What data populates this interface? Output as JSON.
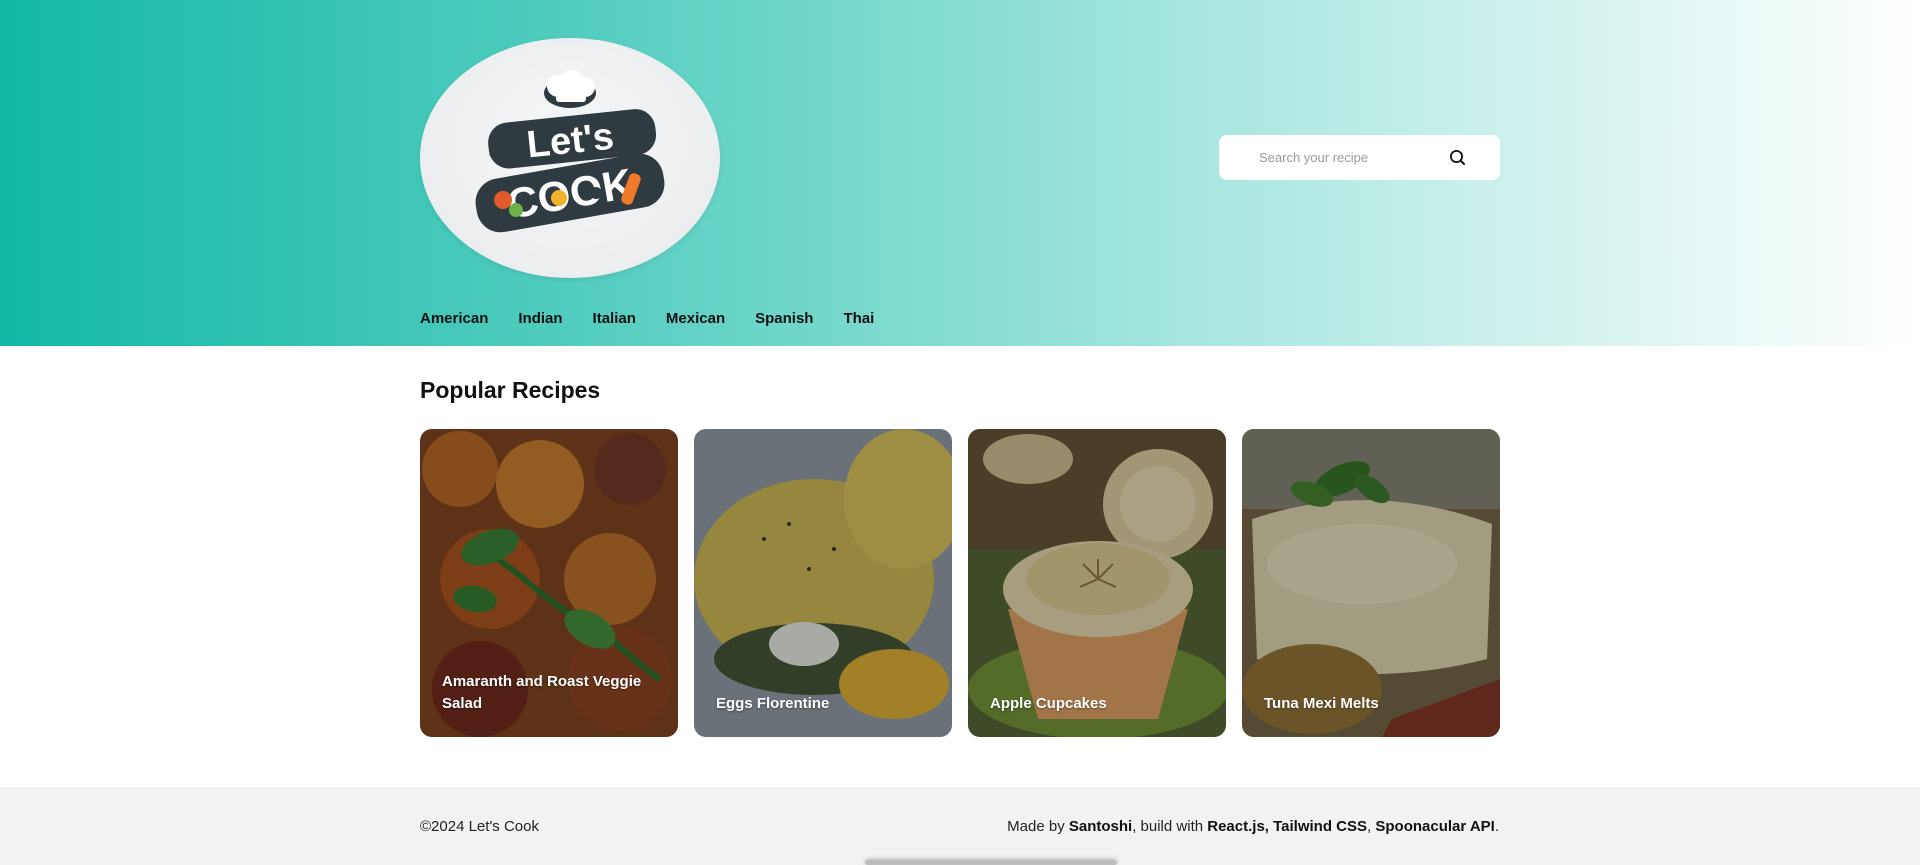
{
  "header": {
    "logo_text_line1": "Let's",
    "logo_text_line2": "COOK"
  },
  "search": {
    "placeholder": "Search your recipe",
    "icon": "search-icon"
  },
  "nav": {
    "items": [
      {
        "label": "American"
      },
      {
        "label": "Indian"
      },
      {
        "label": "Italian"
      },
      {
        "label": "Mexican"
      },
      {
        "label": "Spanish"
      },
      {
        "label": "Thai"
      }
    ]
  },
  "main": {
    "section_title": "Popular Recipes",
    "recipes": [
      {
        "title": "Amaranth and Roast Veggie Salad"
      },
      {
        "title": "Eggs Florentine"
      },
      {
        "title": "Apple Cupcakes"
      },
      {
        "title": "Tuna Mexi Melts"
      }
    ]
  },
  "footer": {
    "copyright": "©2024 Let's Cook",
    "made_by_prefix": "Made by ",
    "author": "Santoshi",
    "build_prefix": ", build with ",
    "tech": "React.js, Tailwind CSS",
    "separator": ", ",
    "api": "Spoonacular API",
    "suffix": "."
  },
  "colors": {
    "brand_teal": "#14b8a6",
    "footer_bg": "#f2f2f2"
  }
}
